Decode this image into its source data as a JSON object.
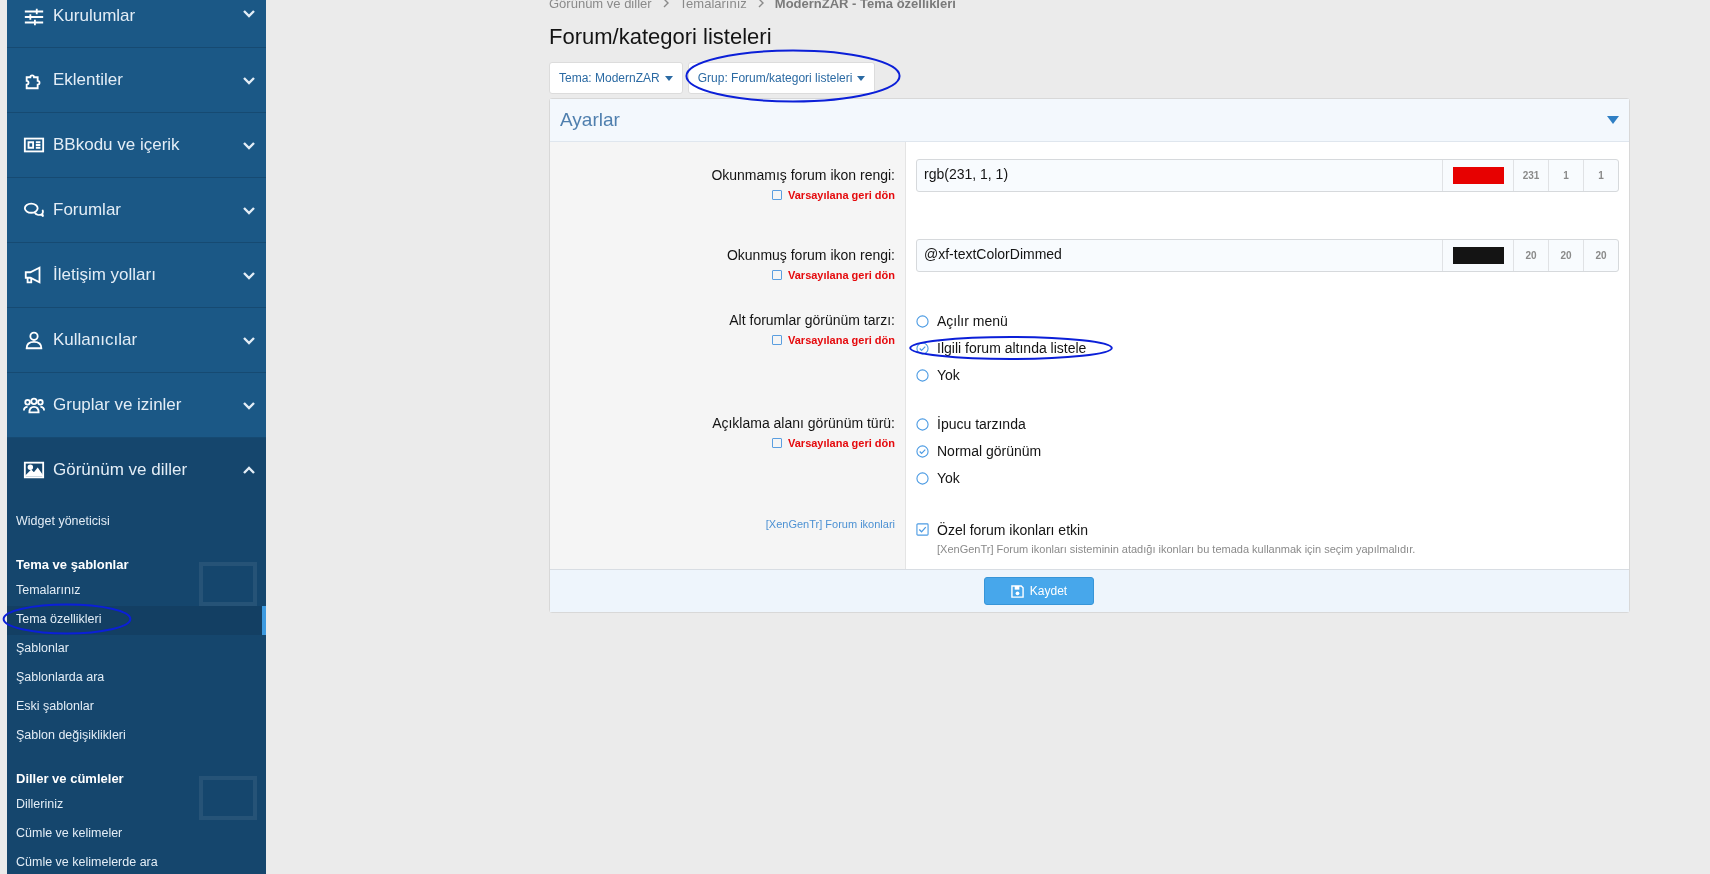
{
  "sidebar": {
    "sections": [
      {
        "label": "Kurulumlar",
        "expanded": false
      },
      {
        "label": "Eklentiler",
        "expanded": false
      },
      {
        "label": "BBkodu ve içerik",
        "expanded": false
      },
      {
        "label": "Forumlar",
        "expanded": false
      },
      {
        "label": "İletişim yolları",
        "expanded": false
      },
      {
        "label": "Kullanıcılar",
        "expanded": false
      },
      {
        "label": "Gruplar ve izinler",
        "expanded": false
      },
      {
        "label": "Görünüm ve diller",
        "expanded": true,
        "groups": [
          {
            "items": [
              {
                "label": "Widget yöneticisi",
                "selected": false,
                "annotated": false
              }
            ]
          },
          {
            "heading": "Tema ve şablonlar",
            "items": [
              {
                "label": "Temalarınız",
                "selected": false,
                "annotated": false
              },
              {
                "label": "Tema özellikleri",
                "selected": true,
                "annotated": true
              },
              {
                "label": "Şablonlar",
                "selected": false,
                "annotated": false
              },
              {
                "label": "Şablonlarda ara",
                "selected": false,
                "annotated": false
              },
              {
                "label": "Eski şablonlar",
                "selected": false,
                "annotated": false
              },
              {
                "label": "Şablon değişiklikleri",
                "selected": false,
                "annotated": false
              }
            ]
          },
          {
            "heading": "Diller ve cümleler",
            "items": [
              {
                "label": "Dilleriniz",
                "selected": false,
                "annotated": false
              },
              {
                "label": "Cümle ve kelimeler",
                "selected": false,
                "annotated": false
              },
              {
                "label": "Cümle ve kelimelerde ara",
                "selected": false,
                "annotated": false
              }
            ]
          }
        ]
      }
    ]
  },
  "breadcrumb": [
    "Görünüm ve diller",
    "Temalarınız",
    "ModernZAR - Tema özellikleri"
  ],
  "title": "Forum/kategori listeleri",
  "filters": [
    {
      "label": "Tema: ModernZAR",
      "annotated": false
    },
    {
      "label": "Grup: Forum/kategori listeleri",
      "annotated": true
    }
  ],
  "panel": {
    "title": "Ayarlar",
    "rows": [
      {
        "kind": "color",
        "label": "Okunmamış forum ikon rengi:",
        "reset": {
          "label": "Varsayılana geri dön",
          "checked": false
        },
        "value": "rgb(231, 1, 1)",
        "color": "#e70101",
        "channels": [
          "231",
          "1",
          "1"
        ]
      },
      {
        "kind": "color",
        "label": "Okunmuş forum ikon rengi:",
        "reset": {
          "label": "Varsayılana geri dön",
          "checked": false
        },
        "value": "@xf-textColorDimmed",
        "color": "#141414",
        "channels": [
          "20",
          "20",
          "20"
        ]
      },
      {
        "kind": "radio",
        "label": "Alt forumlar görünüm tarzı:",
        "reset": {
          "label": "Varsayılana geri dön",
          "checked": false
        },
        "options": [
          {
            "label": "Açılır menü",
            "selected": false,
            "annotated": false
          },
          {
            "label": "İlgili forum altında listele",
            "selected": true,
            "annotated": true
          },
          {
            "label": "Yok",
            "selected": false,
            "annotated": false
          }
        ]
      },
      {
        "kind": "radio",
        "label": "Açıklama alanı görünüm türü:",
        "reset": {
          "label": "Varsayılana geri dön",
          "checked": false
        },
        "options": [
          {
            "label": "İpucu tarzında",
            "selected": false,
            "annotated": false
          },
          {
            "label": "Normal görünüm",
            "selected": true,
            "annotated": false
          },
          {
            "label": "Yok",
            "selected": false,
            "annotated": false
          }
        ]
      },
      {
        "kind": "checkbox",
        "label": "[XenGenTr] Forum ikonlari",
        "option": {
          "label": "Özel forum ikonları etkin",
          "checked": true,
          "hint": "[XenGenTr] Forum ikonları sisteminin atadığı ikonları bu temada kullanmak için seçim yapılmalıdır."
        }
      }
    ],
    "save": "Kaydet"
  }
}
